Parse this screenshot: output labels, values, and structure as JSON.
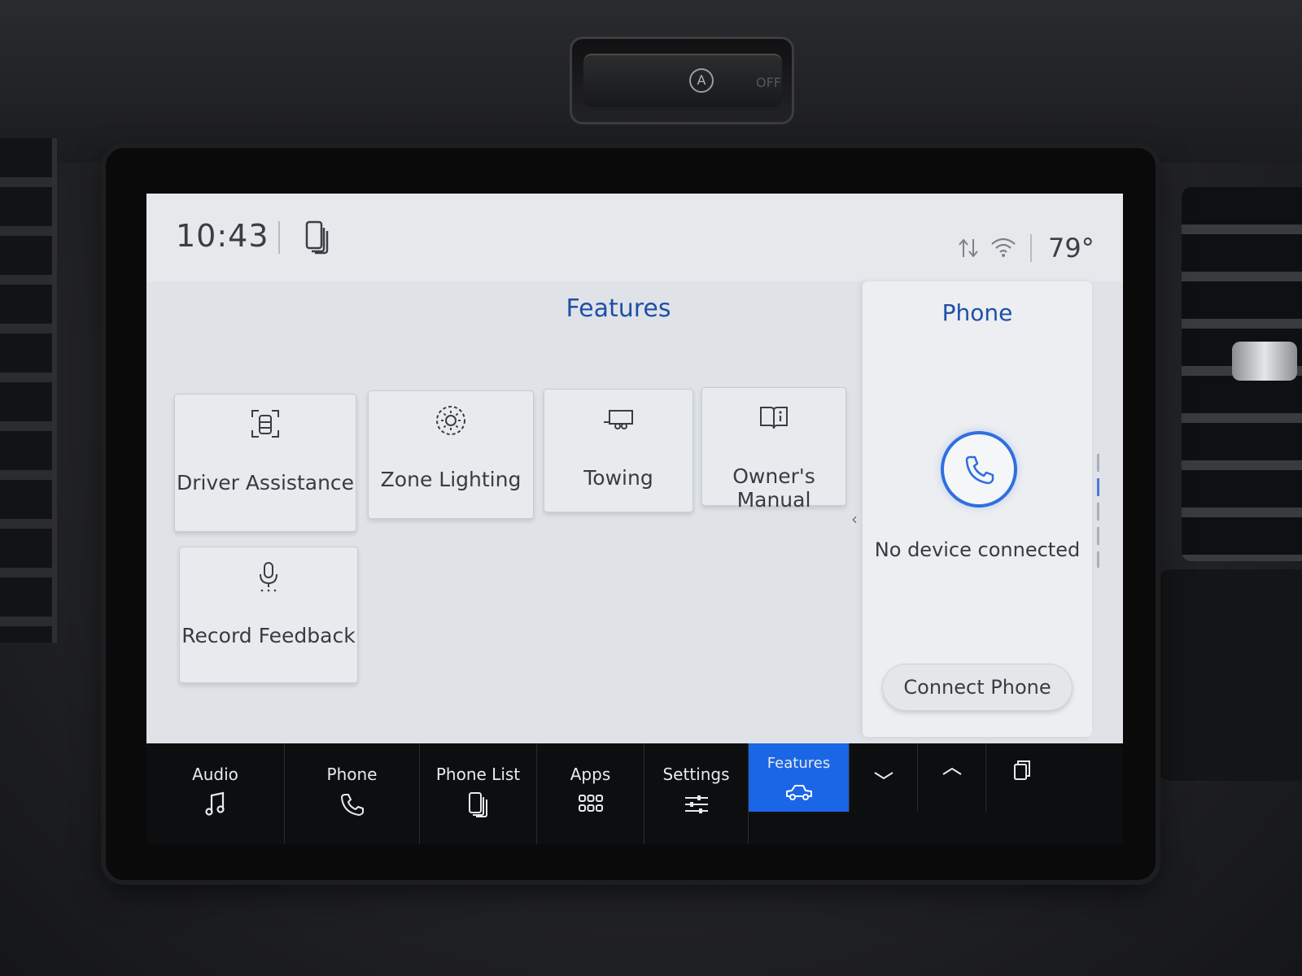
{
  "status": {
    "time": "10:43",
    "temperature": "79°"
  },
  "hazard": {
    "auto_label": "A",
    "off_label": "OFF"
  },
  "features": {
    "title": "Features",
    "tiles": [
      {
        "label": "Driver Assistance",
        "icon": "driver-assistance-icon"
      },
      {
        "label": "Zone Lighting",
        "icon": "zone-lighting-icon"
      },
      {
        "label": "Towing",
        "icon": "trailer-icon"
      },
      {
        "label": "Owner's Manual",
        "icon": "book-icon"
      },
      {
        "label": "Record Feedback",
        "icon": "microphone-icon"
      }
    ]
  },
  "phone_panel": {
    "title": "Phone",
    "status_text": "No device connected",
    "connect_label": "Connect Phone"
  },
  "nav": {
    "items": [
      {
        "label": "Audio",
        "icon": "music-note-icon"
      },
      {
        "label": "Phone",
        "icon": "phone-handset-icon"
      },
      {
        "label": "Phone List",
        "icon": "phone-list-icon"
      },
      {
        "label": "Apps",
        "icon": "apps-grid-icon"
      },
      {
        "label": "Settings",
        "icon": "sliders-icon"
      },
      {
        "label": "Features",
        "icon": "truck-icon",
        "active": true
      }
    ]
  },
  "colors": {
    "accent": "#1a66e6",
    "title_blue": "#1f4fa8",
    "screen_bg": "#dfe3e7",
    "nav_bg": "#0d0e10"
  }
}
